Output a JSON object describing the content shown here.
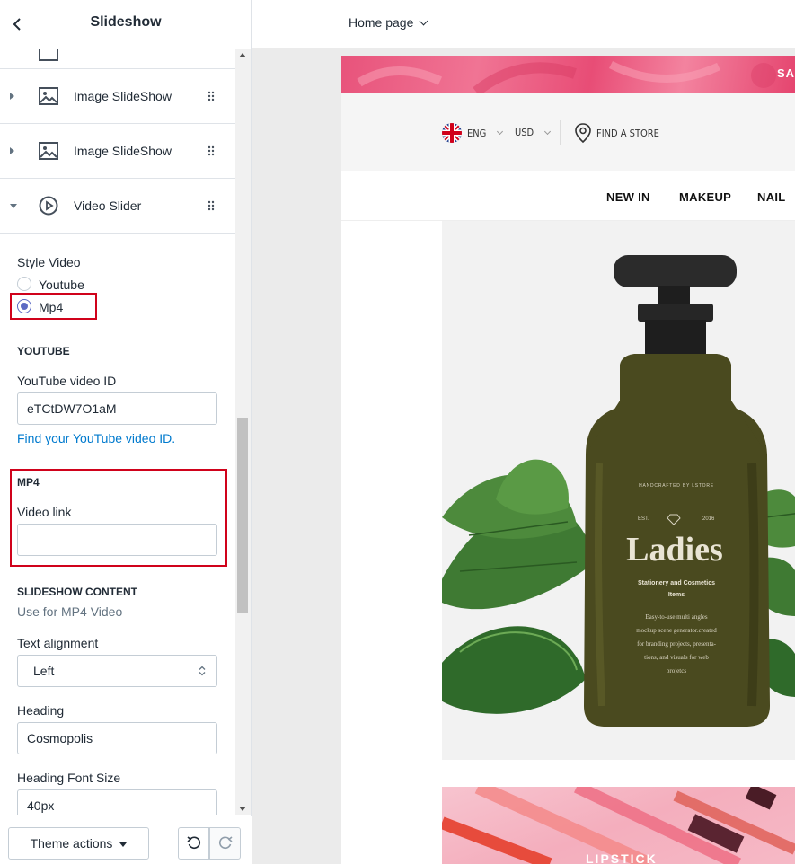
{
  "sidebar": {
    "title": "Slideshow",
    "blocks": [
      {
        "label": "Image SlideShow",
        "icon": "image-icon",
        "expanded": false
      },
      {
        "label": "Image SlideShow",
        "icon": "image-icon",
        "expanded": false
      },
      {
        "label": "Video Slider",
        "icon": "play-circle-icon",
        "expanded": true
      }
    ],
    "settings": {
      "style_video_label": "Style Video",
      "style_video_options": [
        "Youtube",
        "Mp4"
      ],
      "style_video_selected": "Mp4",
      "youtube_heading": "YOUTUBE",
      "youtube_id_label": "YouTube video ID",
      "youtube_id_value": "eTCtDW7O1aM",
      "youtube_help_link": "Find your YouTube video ID.",
      "mp4_heading": "MP4",
      "video_link_label": "Video link",
      "video_link_value": "",
      "content_heading": "SLIDESHOW CONTENT",
      "content_help": "Use for MP4 Video",
      "text_alignment_label": "Text alignment",
      "text_alignment_value": "Left",
      "heading_label": "Heading",
      "heading_value": "Cosmopolis",
      "heading_font_size_label": "Heading Font Size",
      "heading_font_size_value": "40px"
    },
    "footer": {
      "theme_actions_label": "Theme actions"
    }
  },
  "topbar": {
    "page_selector": "Home page"
  },
  "preview": {
    "promo_text": "SA",
    "utility": {
      "language": "ENG",
      "currency": "USD",
      "store_link": "FIND A STORE"
    },
    "nav_items": [
      "NEW IN",
      "MAKEUP",
      "NAIL"
    ],
    "hero": {
      "bottle_brand": "HANDCRAFTED BY LSTORE",
      "est_left": "EST.",
      "est_right": "2016",
      "bottle_title": "Ladies",
      "bottle_subtitle_1": "Stationery and Cosmetics",
      "bottle_subtitle_2": "Items",
      "bottle_desc": [
        "Easy-to-use multi angles",
        "mockup scene generator.created",
        "for branding projects, presenta-",
        "tions, and visuals for web",
        "projetcs"
      ]
    },
    "lipstick_text": "LIPSTICK"
  },
  "colors": {
    "highlight": "#d0021b",
    "link": "#007ace",
    "radio": "#5c6ac4",
    "promo": "#e8537b",
    "bottle": "#4a4a1f"
  }
}
